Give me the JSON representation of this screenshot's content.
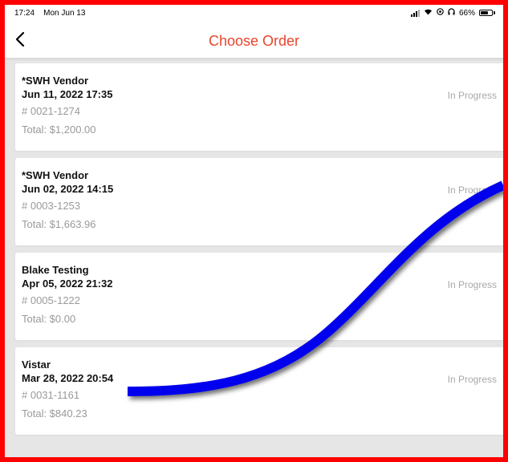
{
  "status_bar": {
    "time": "17:24",
    "date": "Mon Jun 13",
    "battery": "66%",
    "battery_level": 0.66
  },
  "nav": {
    "back_icon": "chevron-left-icon",
    "title": "Choose Order"
  },
  "orders": [
    {
      "vendor": "*SWH Vendor",
      "date": "Jun 11, 2022 17:35",
      "number": "# 0021-1274",
      "total": "Total: $1,200.00",
      "status": "In Progress"
    },
    {
      "vendor": "*SWH Vendor",
      "date": "Jun 02, 2022 14:15",
      "number": "# 0003-1253",
      "total": "Total: $1,663.96",
      "status": "In Progress"
    },
    {
      "vendor": "Blake Testing",
      "date": "Apr 05, 2022 21:32",
      "number": "# 0005-1222",
      "total": "Total: $0.00",
      "status": "In Progress"
    },
    {
      "vendor": "Vistar",
      "date": "Mar 28, 2022 20:54",
      "number": "# 0031-1161",
      "total": "Total: $840.23",
      "status": "In Progress"
    }
  ],
  "colors": {
    "title": "#e8452c",
    "frame_border": "#ff0000",
    "annotation_stroke": "#0000ee"
  }
}
